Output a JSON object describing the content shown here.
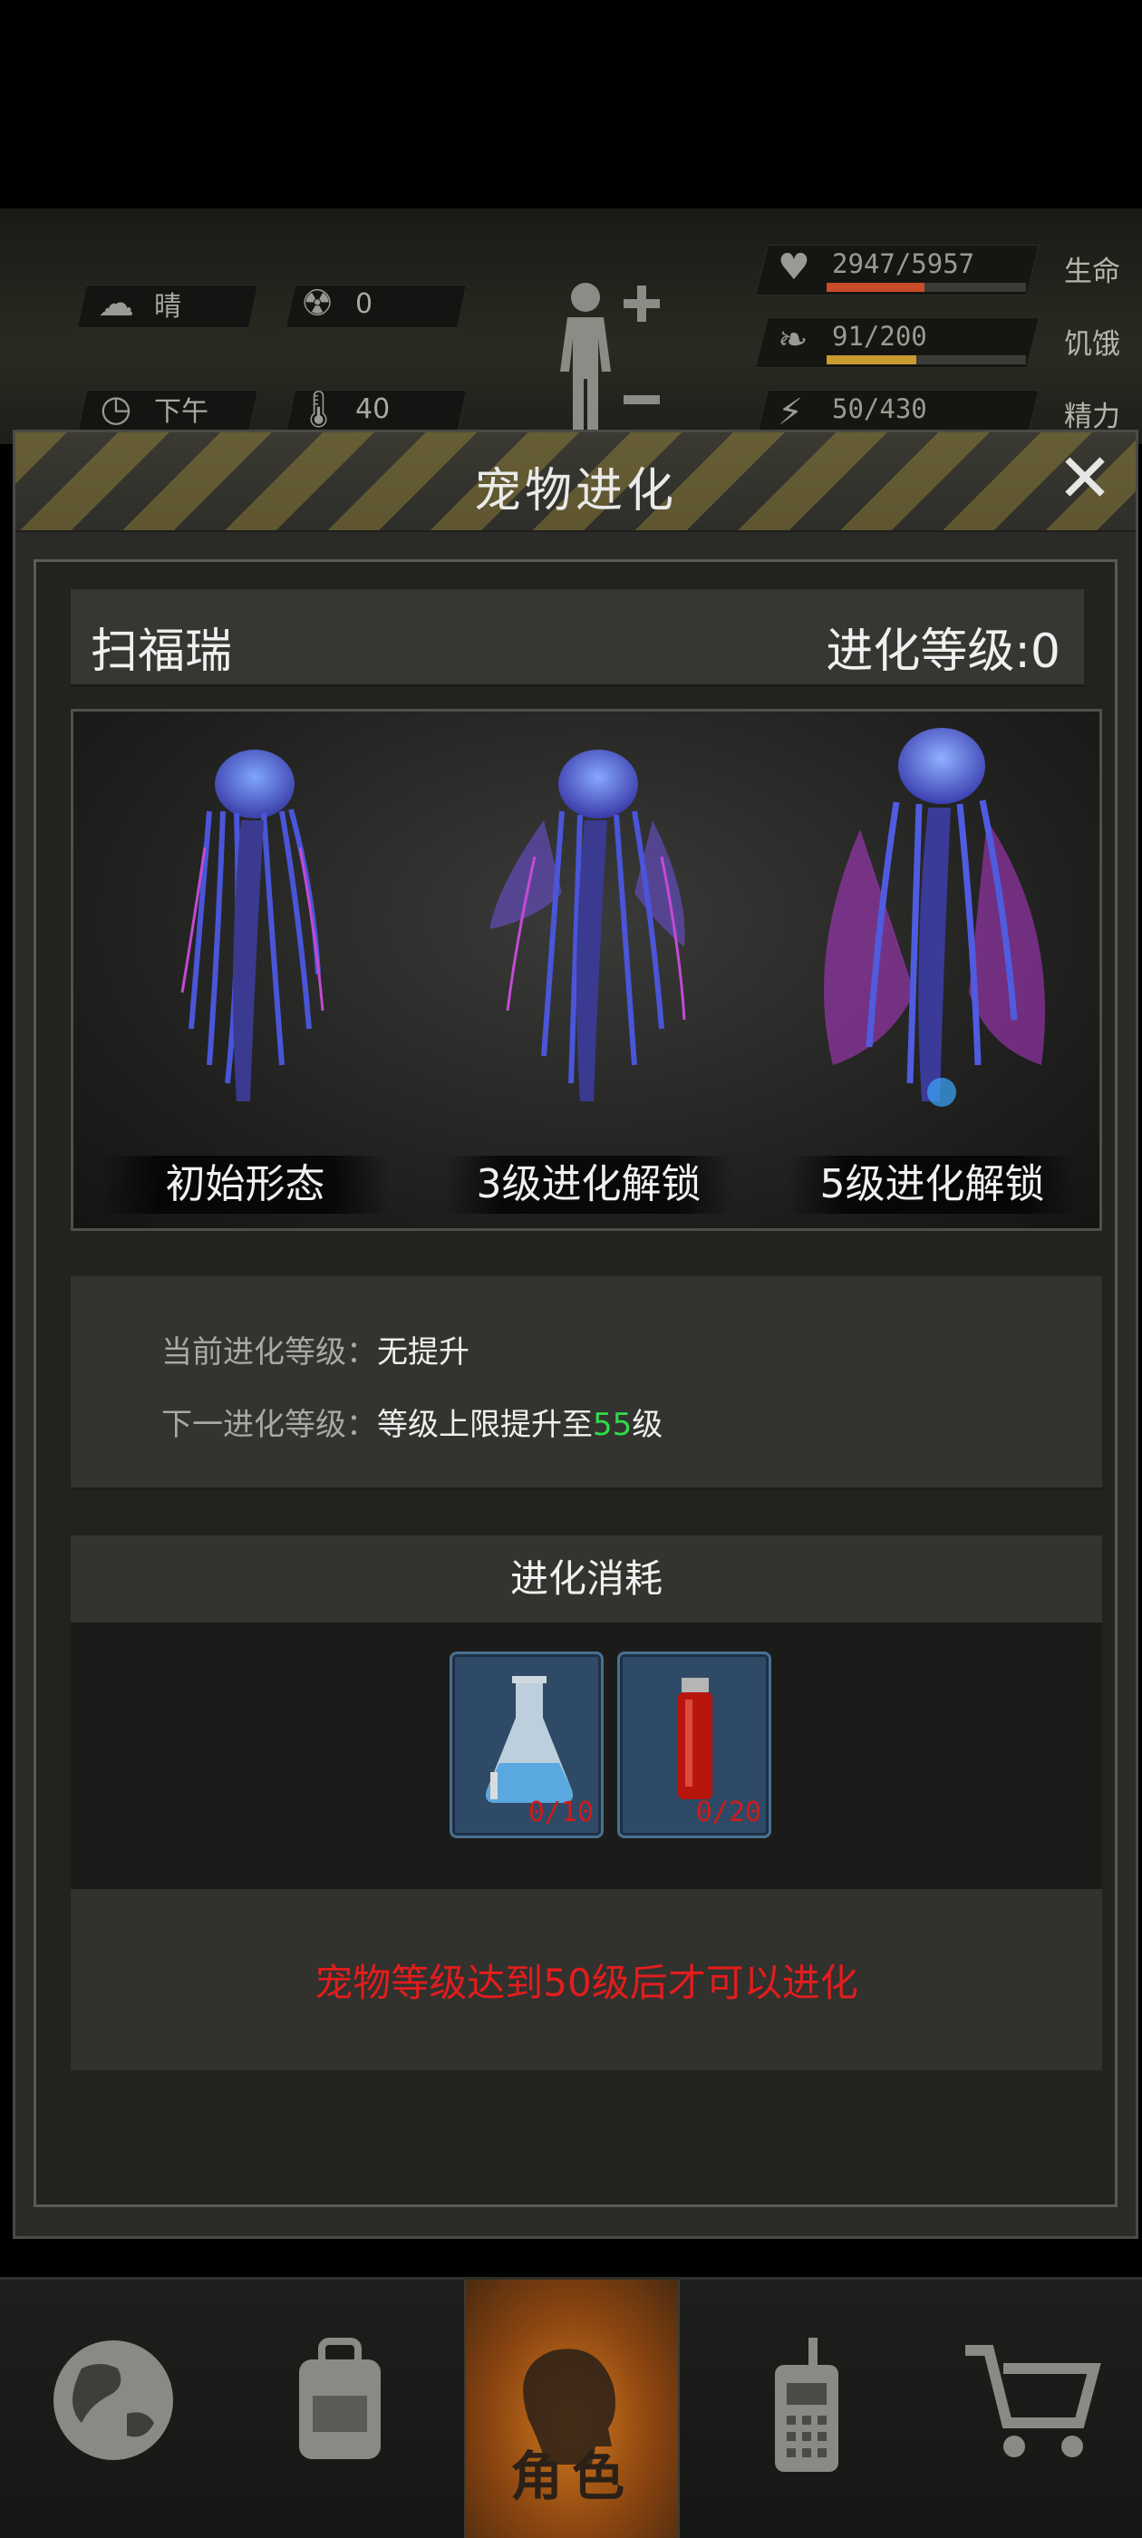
{
  "status": {
    "weather_label": "晴",
    "radiation_value": "0",
    "time_label": "下午",
    "temperature_value": "40",
    "health": {
      "value": "2947/5957",
      "label": "生命",
      "fraction": 0.49,
      "color": "#c84b2a"
    },
    "hunger": {
      "value": "91/200",
      "label": "饥饿",
      "fraction": 0.45,
      "color": "#c99a2e"
    },
    "energy": {
      "value": "50/430",
      "label": "精力"
    }
  },
  "modal": {
    "title": "宠物进化",
    "close_label": "✕",
    "pet_name": "扫福瑞",
    "evo_level_label": "进化等级:0",
    "forms": [
      {
        "caption": "初始形态"
      },
      {
        "caption": "3级进化解锁"
      },
      {
        "caption": "5级进化解锁"
      }
    ],
    "current_key": "当前进化等级：",
    "current_value": "无提升",
    "next_key": "下一进化等级：",
    "next_value_prefix": "等级上限提升至",
    "next_value_num": "55",
    "next_value_suffix": "级",
    "cost_title": "进化消耗",
    "items": [
      {
        "icon": "flask-icon",
        "count": "0/10"
      },
      {
        "icon": "blood-vial-icon",
        "count": "0/20"
      }
    ],
    "warning": "宠物等级达到50级后才可以进化"
  },
  "nav": {
    "items": [
      {
        "icon": "globe-icon"
      },
      {
        "icon": "backpack-icon"
      },
      {
        "icon": "character-head-icon",
        "label": "角色"
      },
      {
        "icon": "radio-icon"
      },
      {
        "icon": "cart-icon"
      }
    ]
  }
}
